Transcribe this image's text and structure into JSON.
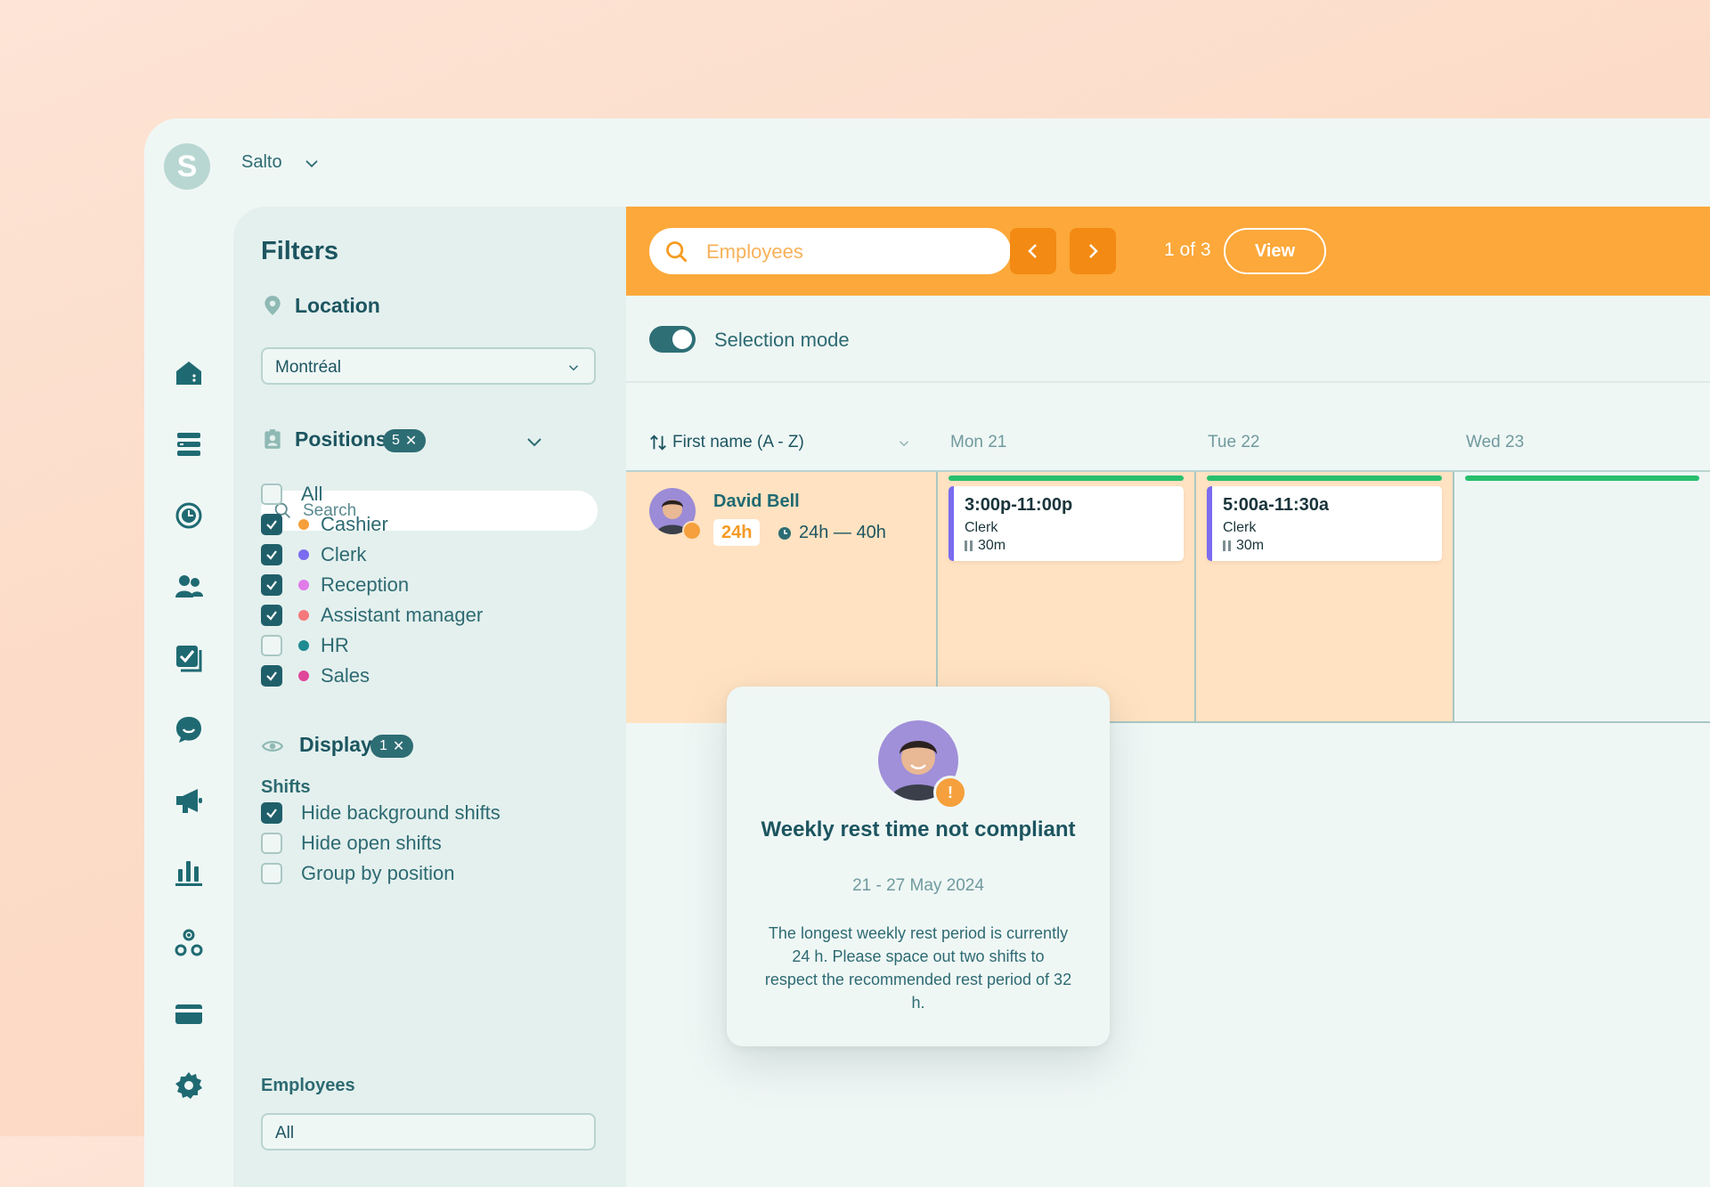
{
  "org": {
    "initial": "S",
    "name": "Salto"
  },
  "nav": [
    "home-icon",
    "list-icon",
    "clock-icon",
    "people-icon",
    "checklist-icon",
    "chat-icon",
    "megaphone-icon",
    "bar-chart-icon",
    "network-icon",
    "card-icon",
    "gear-icon"
  ],
  "filters": {
    "title": "Filters",
    "location": {
      "title": "Location",
      "value": "Montréal"
    },
    "positions": {
      "title": "Positions",
      "badge": "5",
      "search_placeholder": "Search",
      "items": [
        {
          "label": "All",
          "checked": false,
          "color": ""
        },
        {
          "label": "Cashier",
          "checked": true,
          "color": "#f5a03c"
        },
        {
          "label": "Clerk",
          "checked": true,
          "color": "#7a6bf0"
        },
        {
          "label": "Reception",
          "checked": true,
          "color": "#e07be8"
        },
        {
          "label": "Assistant manager",
          "checked": true,
          "color": "#f4797a"
        },
        {
          "label": "HR",
          "checked": false,
          "color": "#1f8a92"
        },
        {
          "label": "Sales",
          "checked": true,
          "color": "#e0469a"
        }
      ]
    },
    "display": {
      "title": "Display",
      "badge": "1",
      "shifts_title": "Shifts",
      "shift_options": [
        {
          "label": "Hide background shifts",
          "checked": true
        },
        {
          "label": "Hide open shifts",
          "checked": false
        },
        {
          "label": "Group by position",
          "checked": false
        }
      ],
      "employees_title": "Employees",
      "employees_value": "All"
    }
  },
  "toolbar": {
    "search_placeholder": "Employees",
    "page": "1 of 3",
    "view_label": "View"
  },
  "selection": {
    "label": "Selection mode",
    "on": true
  },
  "grid": {
    "sort_label": "First name (A - Z)",
    "days": [
      "Mon 21",
      "Tue 22",
      "Wed 23"
    ],
    "employee": {
      "name": "David Bell",
      "hours": "24h",
      "range": "24h — 40h"
    },
    "shifts": [
      {
        "time": "3:00p-11:00p",
        "position": "Clerk",
        "break": "30m"
      },
      {
        "time": "5:00a-11:30a",
        "position": "Clerk",
        "break": "30m"
      }
    ]
  },
  "popover": {
    "title": "Weekly rest time not compliant",
    "date": "21 - 27 May 2024",
    "body": "The longest weekly rest period is currently 24 h. Please space out two shifts to respect the recommended rest period of 32 h."
  }
}
